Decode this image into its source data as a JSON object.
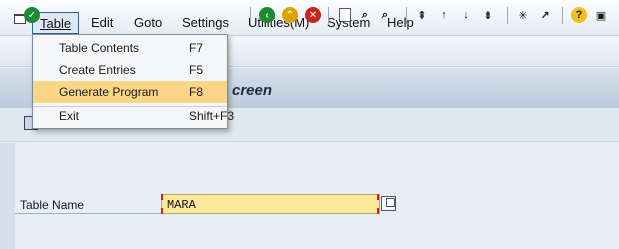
{
  "menubar": {
    "items": [
      {
        "label": "Table",
        "mnemonic_first": "T",
        "rest": "able"
      },
      {
        "label": "Edit"
      },
      {
        "label": "Goto"
      },
      {
        "label": "Settings"
      },
      {
        "label": "Utilities(M)"
      },
      {
        "label": "System"
      },
      {
        "label": "Help"
      }
    ]
  },
  "dropdown": {
    "items": [
      {
        "label": "Table Contents",
        "shortcut": "F7"
      },
      {
        "label": "Create Entries",
        "shortcut": "F5"
      },
      {
        "label": "Generate Program",
        "shortcut": "F8",
        "highlighted": true
      },
      {
        "label": "Exit",
        "shortcut": "Shift+F3"
      }
    ]
  },
  "title": {
    "text": "creen"
  },
  "form": {
    "table_name_label": "Table Name",
    "table_name_value": "MARA"
  },
  "colors": {
    "highlight": "#fbd687",
    "input_bg": "#fce89a",
    "title_bar": "#c7d5e4"
  },
  "toolbar_icons": [
    "enter-icon",
    "back-icon",
    "exit-icon",
    "cancel-icon",
    "print-icon",
    "find-icon",
    "find-next-icon",
    "first-page-icon",
    "previous-page-icon",
    "next-page-icon",
    "last-page-icon",
    "create-session-icon",
    "shortcut-icon",
    "help-icon",
    "customize-layout-icon"
  ]
}
